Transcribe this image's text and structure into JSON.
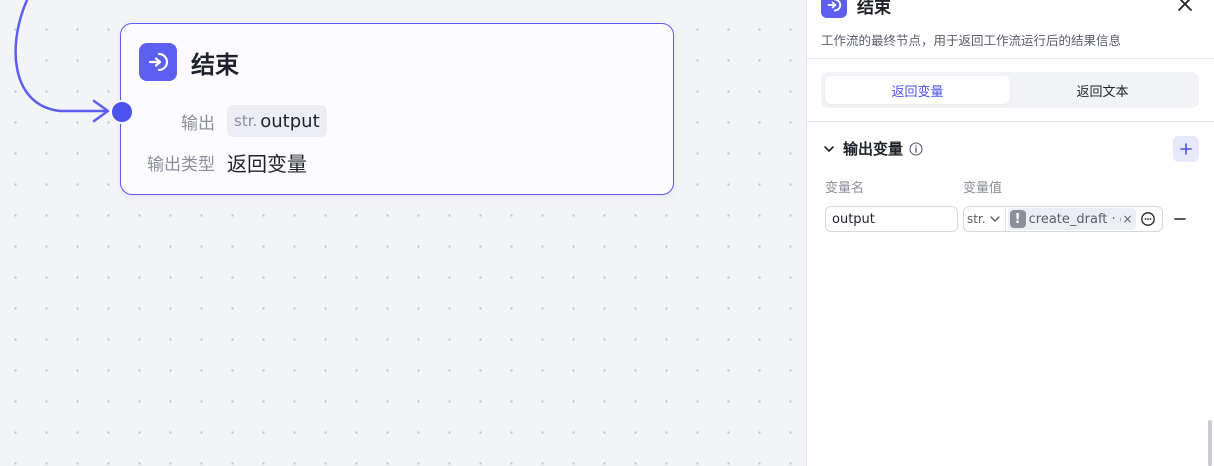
{
  "node": {
    "title": "结束",
    "output_label": "输出",
    "output_var_type": "str.",
    "output_var_name": "output",
    "output_type_label": "输出类型",
    "output_type_value": "返回变量"
  },
  "panel": {
    "title": "结束",
    "description": "工作流的最终节点，用于返回工作流运行后的结果信息",
    "tabs": [
      {
        "label": "返回变量",
        "active": true
      },
      {
        "label": "返回文本",
        "active": false
      }
    ],
    "section_title": "输出变量",
    "col_name": "变量名",
    "col_value": "变量值",
    "row": {
      "name": "output",
      "type": "str.",
      "ref_text": "create_draft · output"
    }
  },
  "colors": {
    "accent": "#5c5ff0",
    "handle": "#4e53ee",
    "canvas_bg": "#f3f4f7"
  },
  "icons": {
    "node_icon": "end-node-icon",
    "close": "close-icon",
    "chevron": "chevron-down-icon",
    "info": "info-icon",
    "add": "plus-icon",
    "remove": "minus-icon",
    "warning": "warning-icon",
    "picker": "variable-picker-icon"
  }
}
